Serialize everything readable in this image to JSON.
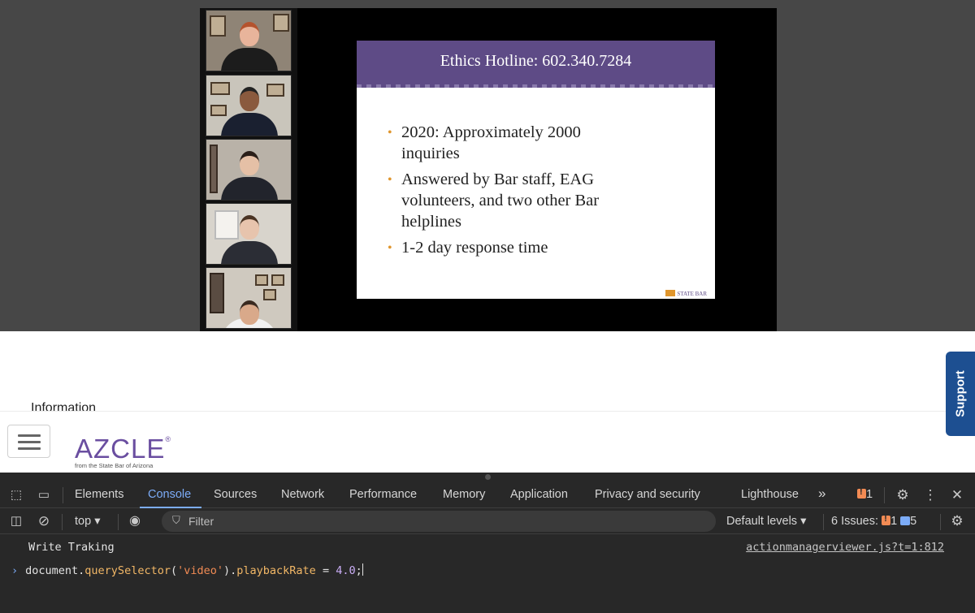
{
  "video": {
    "slide": {
      "title": "Ethics Hotline: 602.340.7284",
      "bullets": [
        "2020: Approximately 2000 inquiries",
        "Answered by Bar staff, EAG volunteers, and two other Bar helplines",
        "1-2 day response time"
      ],
      "logo_text": "STATE BAR"
    },
    "participants": [
      "participant-1",
      "participant-2",
      "participant-3",
      "participant-4",
      "participant-5"
    ]
  },
  "page": {
    "section_heading": "Information",
    "brand": {
      "name": "AZCLE",
      "registered": "®",
      "tagline": "from the State Bar of Arizona"
    },
    "support_label": "Support"
  },
  "devtools": {
    "tabs": [
      "Elements",
      "Console",
      "Sources",
      "Network",
      "Performance",
      "Memory",
      "Application",
      "Privacy and security",
      "Lighthouse"
    ],
    "active_tab": "Console",
    "more_tabs": "»",
    "warning_count": "1",
    "context": "top",
    "filter_placeholder": "Filter",
    "levels": "Default levels",
    "issues_label": "6 Issues:",
    "issues_warn": "1",
    "issues_info": "5",
    "log": {
      "message": "Write Traking",
      "source": "actionmanagerviewer.js?t=1:812"
    },
    "input": {
      "prefix": "document.",
      "method": "querySelector",
      "open": "(",
      "arg": "'video'",
      "close": ").",
      "prop": "playbackRate",
      "op": " = ",
      "value": "4.0",
      "end": ";"
    }
  },
  "colors": {
    "slide_header": "#5e4b86",
    "bullet": "#e0962d",
    "brand": "#6a4ea0",
    "support": "#1d4f91",
    "devtools_accent": "#7cacf8"
  }
}
